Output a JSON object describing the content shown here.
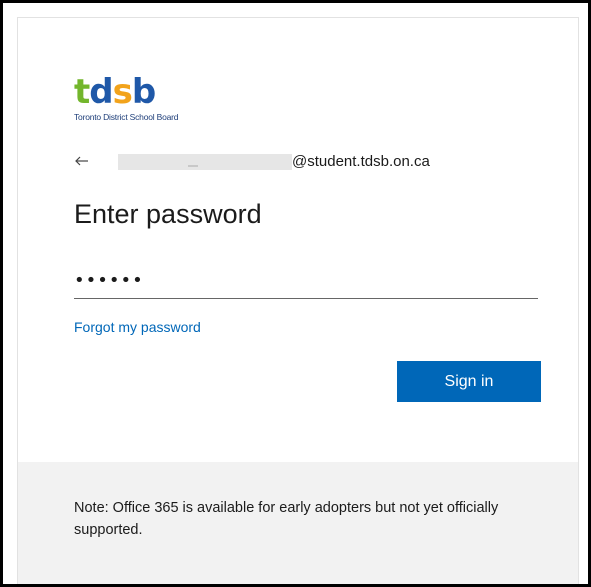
{
  "logo": {
    "word_letters": [
      "t",
      "d",
      "s",
      "b"
    ],
    "subtitle": "Toronto District School Board",
    "colors": {
      "t": "#73b62c",
      "d": "#1f58a8",
      "s": "#f2a31b",
      "b": "#1f58a8"
    }
  },
  "identity": {
    "back_icon": "arrow-left-icon",
    "email_suffix": "@student.tdsb.on.ca"
  },
  "heading": "Enter password",
  "password": {
    "value": "••••••"
  },
  "forgot_link": "Forgot my password",
  "signin_button": "Sign in",
  "note": "Note: Office 365 is available for early adopters but not yet officially supported.",
  "colors": {
    "accent": "#0067b8",
    "footer_bg": "#f2f2f2"
  }
}
